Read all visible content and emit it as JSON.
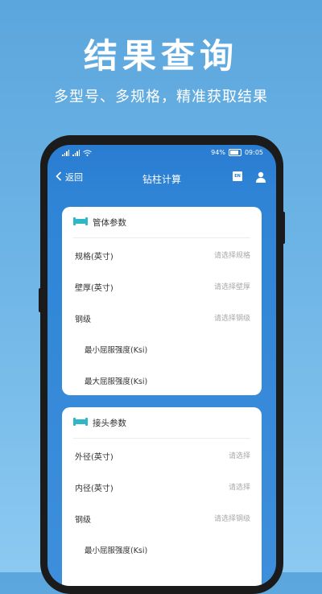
{
  "promo": {
    "title": "结果查询",
    "subtitle": "多型号、多规格，精准获取结果"
  },
  "status_bar": {
    "battery": "94%",
    "time": "09:05"
  },
  "nav": {
    "back_label": "返回",
    "title": "钻柱计算",
    "lang_badge": "EN"
  },
  "pipe_section": {
    "title": "管体参数",
    "rows": [
      {
        "label": "规格(英寸)",
        "placeholder": "请选择规格"
      },
      {
        "label": "壁厚(英寸)",
        "placeholder": "请选择壁厚"
      },
      {
        "label": "钢级",
        "placeholder": "请选择钢级"
      },
      {
        "label": "最小屈服强度(Ksi)",
        "placeholder": ""
      },
      {
        "label": "最大屈服强度(Ksi)",
        "placeholder": ""
      }
    ]
  },
  "joint_section": {
    "title": "接头参数",
    "rows": [
      {
        "label": "外径(英寸)",
        "placeholder": "请选择"
      },
      {
        "label": "内径(英寸)",
        "placeholder": "请选择"
      },
      {
        "label": "钢级",
        "placeholder": "请选择钢级"
      },
      {
        "label": "最小屈服强度(Ksi)",
        "placeholder": ""
      }
    ]
  }
}
